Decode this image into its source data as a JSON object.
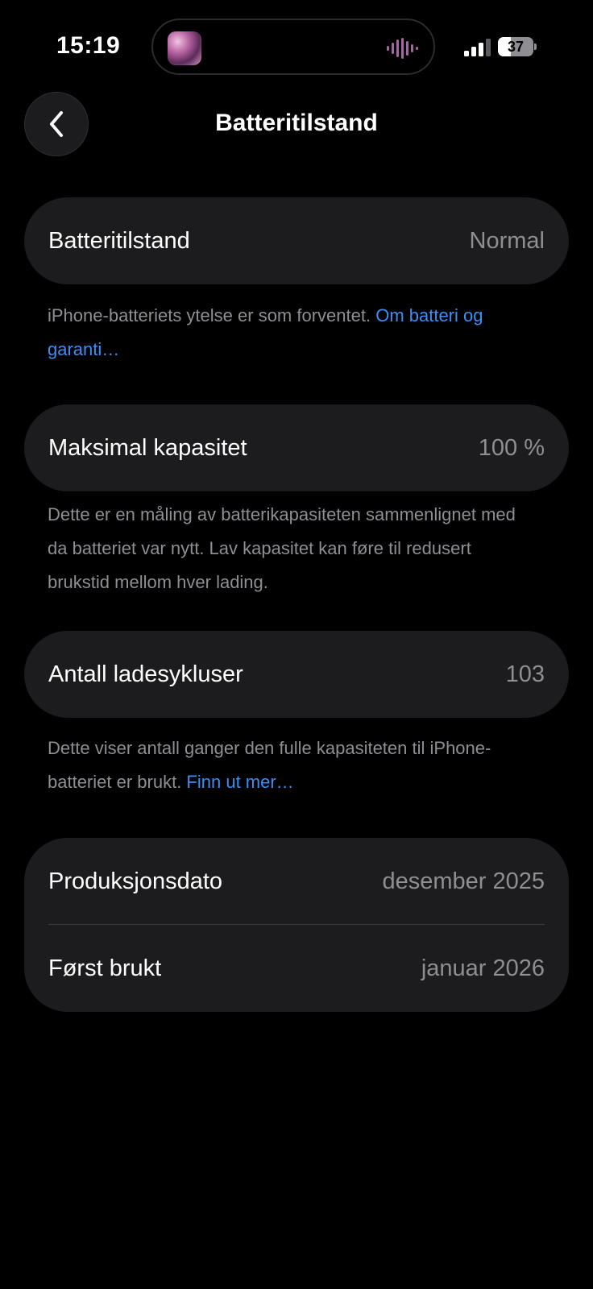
{
  "status_bar": {
    "time": "15:19",
    "battery_percent": "37",
    "battery_level": 0.37,
    "signal_bars_active": 3,
    "signal_bars_total": 4
  },
  "colors": {
    "background": "#000000",
    "card": "#1c1c1e",
    "secondary_text": "#8e8e93",
    "link": "#3a8ff7",
    "island_wave": "#a06aa0"
  },
  "header": {
    "back_icon": "chevron-left-icon",
    "title": "Batteritilstand"
  },
  "battery_health": {
    "label": "Batteritilstand",
    "value": "Normal",
    "footnote_text": "iPhone-batteriets ytelse er som forventet. ",
    "footnote_link": "Om batteri og garanti…"
  },
  "max_capacity": {
    "label": "Maksimal kapasitet",
    "value": "100 %",
    "footnote_text": "Dette er en måling av batterikapasiteten sammenlignet med da batteriet var nytt. Lav kapasitet kan føre til redusert brukstid mellom hver lading."
  },
  "cycle_count": {
    "label": "Antall ladesykluser",
    "value": "103",
    "footnote_text": "Dette viser antall ganger den fulle kapasiteten til iPhone-batteriet er brukt. ",
    "footnote_link": "Finn ut mer…"
  },
  "dates": {
    "manufacture_label": "Produksjonsdato",
    "manufacture_value": "desember 2025",
    "first_use_label": "Først brukt",
    "first_use_value": "januar 2026"
  }
}
